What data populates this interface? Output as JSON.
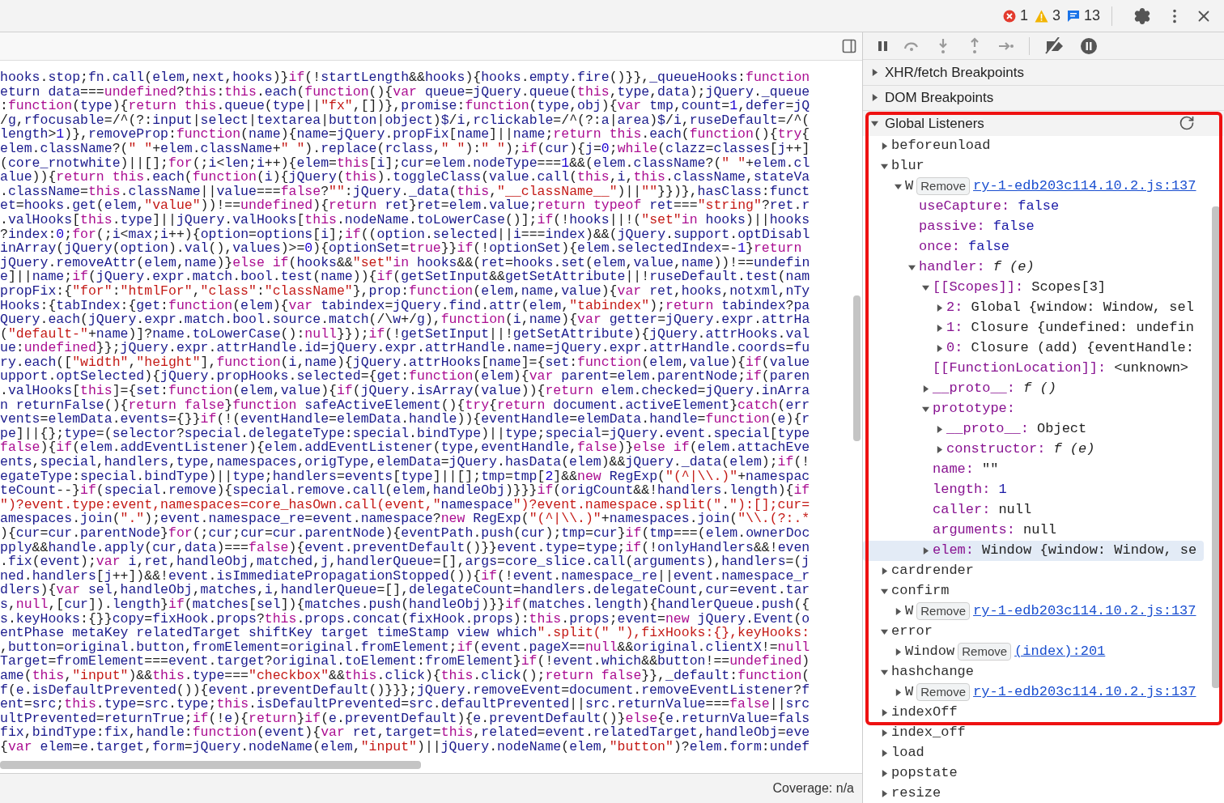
{
  "toolbar": {
    "issues": [
      {
        "kind": "error",
        "count": "1"
      },
      {
        "kind": "warning",
        "count": "3"
      },
      {
        "kind": "info",
        "count": "13"
      }
    ]
  },
  "editor": {
    "code_lines": [
      "hooks.stop;fn.call(elem,next,hooks)}if(!startLength&&hooks){hooks.empty.fire()}},_queueHooks:function",
      "eturn data===undefined?this:this.each(function(){var queue=jQuery.queue(this,type,data);jQuery._queue",
      ":function(type){return this.queue(type||\"fx\",[])},promise:function(type,obj){var tmp,count=1,defer=jQ",
      "/g,rfocusable=/^(?:input|select|textarea|button|object)$/i,rclickable=/^(?:a|area)$/i,ruseDefault=/^(",
      "length>1)},removeProp:function(name){name=jQuery.propFix[name]||name;return this.each(function(){try{",
      "elem.className?(\" \"+elem.className+\" \").replace(rclass,\" \"):\" \");if(cur){j=0;while(clazz=classes[j++]",
      "(core_rnotwhite)||[];for(;i<len;i++){elem=this[i];cur=elem.nodeType===1&&(elem.className?(\" \"+elem.cl",
      "alue)){return this.each(function(i){jQuery(this).toggleClass(value.call(this,i,this.className,stateVa",
      ".className=this.className||value===false?\"\":jQuery._data(this,\"__className__\")||\"\"}})},hasClass:funct",
      "et=hooks.get(elem,\"value\"))!==undefined){return ret}ret=elem.value;return typeof ret===\"string\"?ret.r",
      ".valHooks[this.type]||jQuery.valHooks[this.nodeName.toLowerCase()];if(!hooks||!(\"set\"in hooks)||hooks",
      "?index:0;for(;i<max;i++){option=options[i];if((option.selected||i===index)&&(jQuery.support.optDisabl",
      "inArray(jQuery(option).val(),values)>=0){optionSet=true}}if(!optionSet){elem.selectedIndex=-1}return",
      "jQuery.removeAttr(elem,name)}else if(hooks&&\"set\"in hooks&&(ret=hooks.set(elem,value,name))!==undefin",
      "e]||name;if(jQuery.expr.match.bool.test(name)){if(getSetInput&&getSetAttribute||!ruseDefault.test(nam",
      "propFix:{\"for\":\"htmlFor\",\"class\":\"className\"},prop:function(elem,name,value){var ret,hooks,notxml,nTy",
      "Hooks:{tabIndex:{get:function(elem){var tabindex=jQuery.find.attr(elem,\"tabindex\");return tabindex?pa",
      "Query.each(jQuery.expr.match.bool.source.match(/\\w+/g),function(i,name){var getter=jQuery.expr.attrHa",
      "(\"default-\"+name)]?name.toLowerCase():null}});if(!getSetInput||!getSetAttribute){jQuery.attrHooks.val",
      "ue:undefined}};jQuery.expr.attrHandle.id=jQuery.expr.attrHandle.name=jQuery.expr.attrHandle.coords=fu",
      "ry.each([\"width\",\"height\"],function(i,name){jQuery.attrHooks[name]={set:function(elem,value){if(value",
      "upport.optSelected){jQuery.propHooks.selected={get:function(elem){var parent=elem.parentNode;if(paren",
      ".valHooks[this]={set:function(elem,value){if(jQuery.isArray(value)){return elem.checked=jQuery.inArra",
      "n returnFalse(){return false}function safeActiveElement(){try{return document.activeElement}catch(err",
      "vents=elemData.events={}}if(!(eventHandle=elemData.handle)){eventHandle=elemData.handle=function(e){r",
      "pe]||{};type=(selector?special.delegateType:special.bindType)||type;special=jQuery.event.special[type",
      "false){if(elem.addEventListener){elem.addEventListener(type,eventHandle,false)}else if(elem.attachEve",
      "ents,special,handlers,type,namespaces,origType,elemData=jQuery.hasData(elem)&&jQuery._data(elem);if(!",
      "egateType:special.bindType)||type;handlers=events[type]||[];tmp=tmp[2]&&new RegExp(\"(^|\\\\.)\"+namespac",
      "teCount--}if(special.remove){special.remove.call(elem,handleObj)}}}if(origCount&&!handlers.length){if",
      "\")?event.type:event,namespaces=core_hasOwn.call(event,\"namespace\")?event.namespace.split(\".\"):[];cur=",
      "amespaces.join(\".\");event.namespace_re=event.namespace?new RegExp(\"(^|\\\\.)\"+namespaces.join(\"\\\\.(?:.*",
      "){cur=cur.parentNode}for(;cur;cur=cur.parentNode){eventPath.push(cur);tmp=cur}if(tmp===(elem.ownerDoc",
      "pply&&handle.apply(cur,data)===false){event.preventDefault()}}event.type=type;if(!onlyHandlers&&!even",
      ".fix(event);var i,ret,handleObj,matched,j,handlerQueue=[],args=core_slice.call(arguments),handlers=(j",
      "ned.handlers[j++])&&!event.isImmediatePropagationStopped()){if(!event.namespace_re||event.namespace_r",
      "dlers){var sel,handleObj,matches,i,handlerQueue=[],delegateCount=handlers.delegateCount,cur=event.tar",
      "s,null,[cur]).length}if(matches[sel]){matches.push(handleObj)}}if(matches.length){handlerQueue.push({",
      "s.keyHooks:{}}copy=fixHook.props?this.props.concat(fixHook.props):this.props;event=new jQuery.Event(o",
      "entPhase metaKey relatedTarget shiftKey target timeStamp view which\".split(\" \"),fixHooks:{},keyHooks:",
      ",button=original.button,fromElement=original.fromElement;if(event.pageX==null&&original.clientX!=null",
      "Target=fromElement===event.target?original.toElement:fromElement}if(!event.which&&button!==undefined)",
      "ame(this,\"input\")&&this.type===\"checkbox\"&&this.click){this.click();return false}},_default:function(",
      "f(e.isDefaultPrevented()){event.preventDefault()}}};jQuery.removeEvent=document.removeEventListener?f",
      "ent=src;this.type=src.type;this.isDefaultPrevented=src.defaultPrevented||src.returnValue===false||src",
      "ultPrevented=returnTrue;if(!e){return}if(e.preventDefault){e.preventDefault()}else{e.returnValue=fals",
      "fix,bindType:fix,handle:function(event){var ret,target=this,related=event.relatedTarget,handleObj=eve",
      "{var elem=e.target,form=jQuery.nodeName(elem,\"input\")||jQuery.nodeName(elem,\"button\")?elem.form:undef"
    ]
  },
  "status_bar": {
    "coverage": "Coverage: n/a"
  },
  "sidebar": {
    "sections": [
      {
        "title": "XHR/fetch Breakpoints",
        "expanded": false
      },
      {
        "title": "DOM Breakpoints",
        "expanded": false
      },
      {
        "title": "Global Listeners",
        "expanded": true,
        "listeners": [
          {
            "kind": "event",
            "name": "beforeunload",
            "expanded": false,
            "selected": false
          },
          {
            "kind": "event",
            "name": "blur",
            "expanded": true,
            "selected": false,
            "children": [
              {
                "kind": "listener",
                "target": "W",
                "remove": "Remove",
                "source": "ry-1-edb203c114.10.2.js:137",
                "expanded": true,
                "selected": false,
                "children": [
                  {
                    "kind": "leaf",
                    "key": "useCapture:",
                    "value": "false",
                    "literal": true,
                    "italic": false,
                    "selected": false
                  },
                  {
                    "kind": "leaf",
                    "key": "passive:",
                    "value": "false",
                    "literal": true,
                    "italic": false,
                    "selected": false
                  },
                  {
                    "kind": "leaf",
                    "key": "once:",
                    "value": "false",
                    "literal": true,
                    "italic": false,
                    "selected": false
                  },
                  {
                    "kind": "branch",
                    "key": "handler:",
                    "value": "f (e)",
                    "literal": false,
                    "italic": true,
                    "expanded": true,
                    "selected": false,
                    "children": [
                      {
                        "kind": "branch",
                        "key": "[[Scopes]]:",
                        "value": "Scopes[3]",
                        "literal": false,
                        "italic": false,
                        "expanded": true,
                        "selected": false,
                        "children": [
                          {
                            "kind": "branch",
                            "key": "2:",
                            "value": "Global {window: Window, sel",
                            "literal": false,
                            "italic": false,
                            "expanded": false,
                            "selected": false
                          },
                          {
                            "kind": "branch",
                            "key": "1:",
                            "value": "Closure {undefined: undefin",
                            "literal": false,
                            "italic": false,
                            "expanded": false,
                            "selected": false
                          },
                          {
                            "kind": "branch",
                            "key": "0:",
                            "value": "Closure (add) {eventHandle:",
                            "literal": false,
                            "italic": false,
                            "expanded": false,
                            "selected": false
                          }
                        ]
                      },
                      {
                        "kind": "leaf",
                        "key": "[[FunctionLocation]]:",
                        "value": "<unknown>",
                        "literal": false,
                        "italic": false,
                        "selected": false
                      },
                      {
                        "kind": "branch",
                        "key": "__proto__:",
                        "value": "f ()",
                        "literal": false,
                        "italic": true,
                        "expanded": false,
                        "selected": false
                      },
                      {
                        "kind": "branch",
                        "key": "prototype:",
                        "expanded": true,
                        "selected": false,
                        "children": [
                          {
                            "kind": "branch",
                            "key": "__proto__:",
                            "value": "Object",
                            "literal": false,
                            "italic": false,
                            "expanded": false,
                            "selected": false
                          },
                          {
                            "kind": "branch",
                            "key": "constructor:",
                            "value": "f (e)",
                            "literal": false,
                            "italic": true,
                            "expanded": false,
                            "selected": false
                          }
                        ]
                      },
                      {
                        "kind": "leaf",
                        "key": "name:",
                        "value": "\"\"",
                        "literal": false,
                        "italic": false,
                        "selected": false
                      },
                      {
                        "kind": "leaf",
                        "key": "length:",
                        "value": "1",
                        "literal": true,
                        "italic": false,
                        "selected": false
                      },
                      {
                        "kind": "leaf",
                        "key": "caller:",
                        "value": "null",
                        "literal": false,
                        "italic": false,
                        "selected": false
                      },
                      {
                        "kind": "leaf",
                        "key": "arguments:",
                        "value": "null",
                        "literal": false,
                        "italic": false,
                        "selected": false
                      },
                      {
                        "kind": "branch",
                        "key": "elem:",
                        "value": "Window {window: Window, se",
                        "literal": false,
                        "italic": false,
                        "expanded": false,
                        "selected": true
                      }
                    ]
                  }
                ]
              }
            ]
          },
          {
            "kind": "event",
            "name": "cardrender",
            "expanded": false,
            "selected": false
          },
          {
            "kind": "event",
            "name": "confirm",
            "expanded": true,
            "selected": false,
            "children": [
              {
                "kind": "listener",
                "target": "W",
                "remove": "Remove",
                "source": "ry-1-edb203c114.10.2.js:137",
                "expanded": false,
                "selected": false
              }
            ]
          },
          {
            "kind": "event",
            "name": "error",
            "expanded": true,
            "selected": false,
            "children": [
              {
                "kind": "listener",
                "target": "Window",
                "remove": "Remove",
                "source": "(index):201",
                "expanded": false,
                "selected": false
              }
            ]
          },
          {
            "kind": "event",
            "name": "hashchange",
            "expanded": true,
            "selected": false,
            "children": [
              {
                "kind": "listener",
                "target": "W",
                "remove": "Remove",
                "source": "ry-1-edb203c114.10.2.js:137",
                "expanded": false,
                "selected": false
              }
            ]
          },
          {
            "kind": "event",
            "name": "indexOff",
            "expanded": false,
            "selected": false
          },
          {
            "kind": "event",
            "name": "index_off",
            "expanded": false,
            "selected": false
          },
          {
            "kind": "event",
            "name": "load",
            "expanded": false,
            "selected": false
          },
          {
            "kind": "event",
            "name": "popstate",
            "expanded": false,
            "selected": false
          },
          {
            "kind": "event",
            "name": "resize",
            "expanded": false,
            "selected": false
          }
        ]
      }
    ]
  }
}
